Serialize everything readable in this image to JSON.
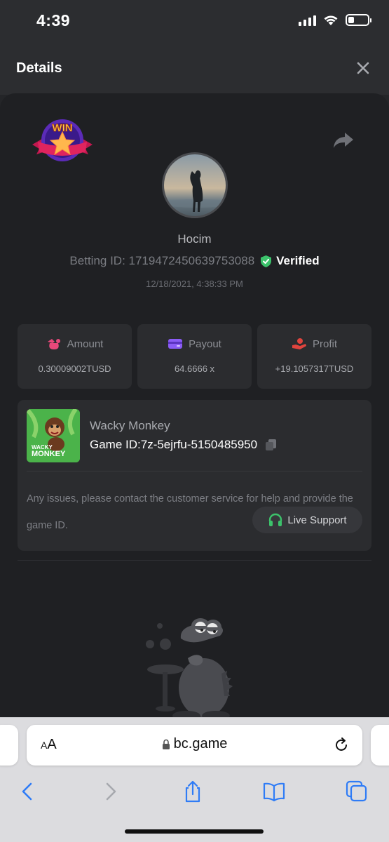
{
  "status_bar": {
    "time": "4:39"
  },
  "header": {
    "title": "Details"
  },
  "bet": {
    "username": "Hocim",
    "betting_id_label": "Betting ID: 1719472450639753088",
    "verified_label": "Verified",
    "datetime": "12/18/2021, 4:38:33 PM",
    "win_badge_text": "WIN"
  },
  "stats": [
    {
      "label": "Amount",
      "value": "0.30009002TUSD",
      "icon": "money-bag-icon",
      "color": "#e9487a"
    },
    {
      "label": "Payout",
      "value": "64.6666 x",
      "icon": "card-icon",
      "color": "#8b5cf6"
    },
    {
      "label": "Profit",
      "value": "+19.1057317TUSD",
      "icon": "hand-coin-icon",
      "color": "#e0443e"
    }
  ],
  "game": {
    "name": "Wacky Monkey",
    "game_id_label": "Game ID:7z-5ejrfu-5150485950",
    "thumb_line1": "WACKY",
    "thumb_line2": "MONKEY",
    "issue_text": "Any issues, please contact the customer service for help and provide the game ID.",
    "support_label": "Live Support"
  },
  "browser": {
    "aa_label_small": "A",
    "aa_label_big": "A",
    "url": "bc.game"
  },
  "colors": {
    "verified": "#3cc26b",
    "support_icon": "#3cc26b",
    "accent_blue": "#2f7cf6"
  }
}
